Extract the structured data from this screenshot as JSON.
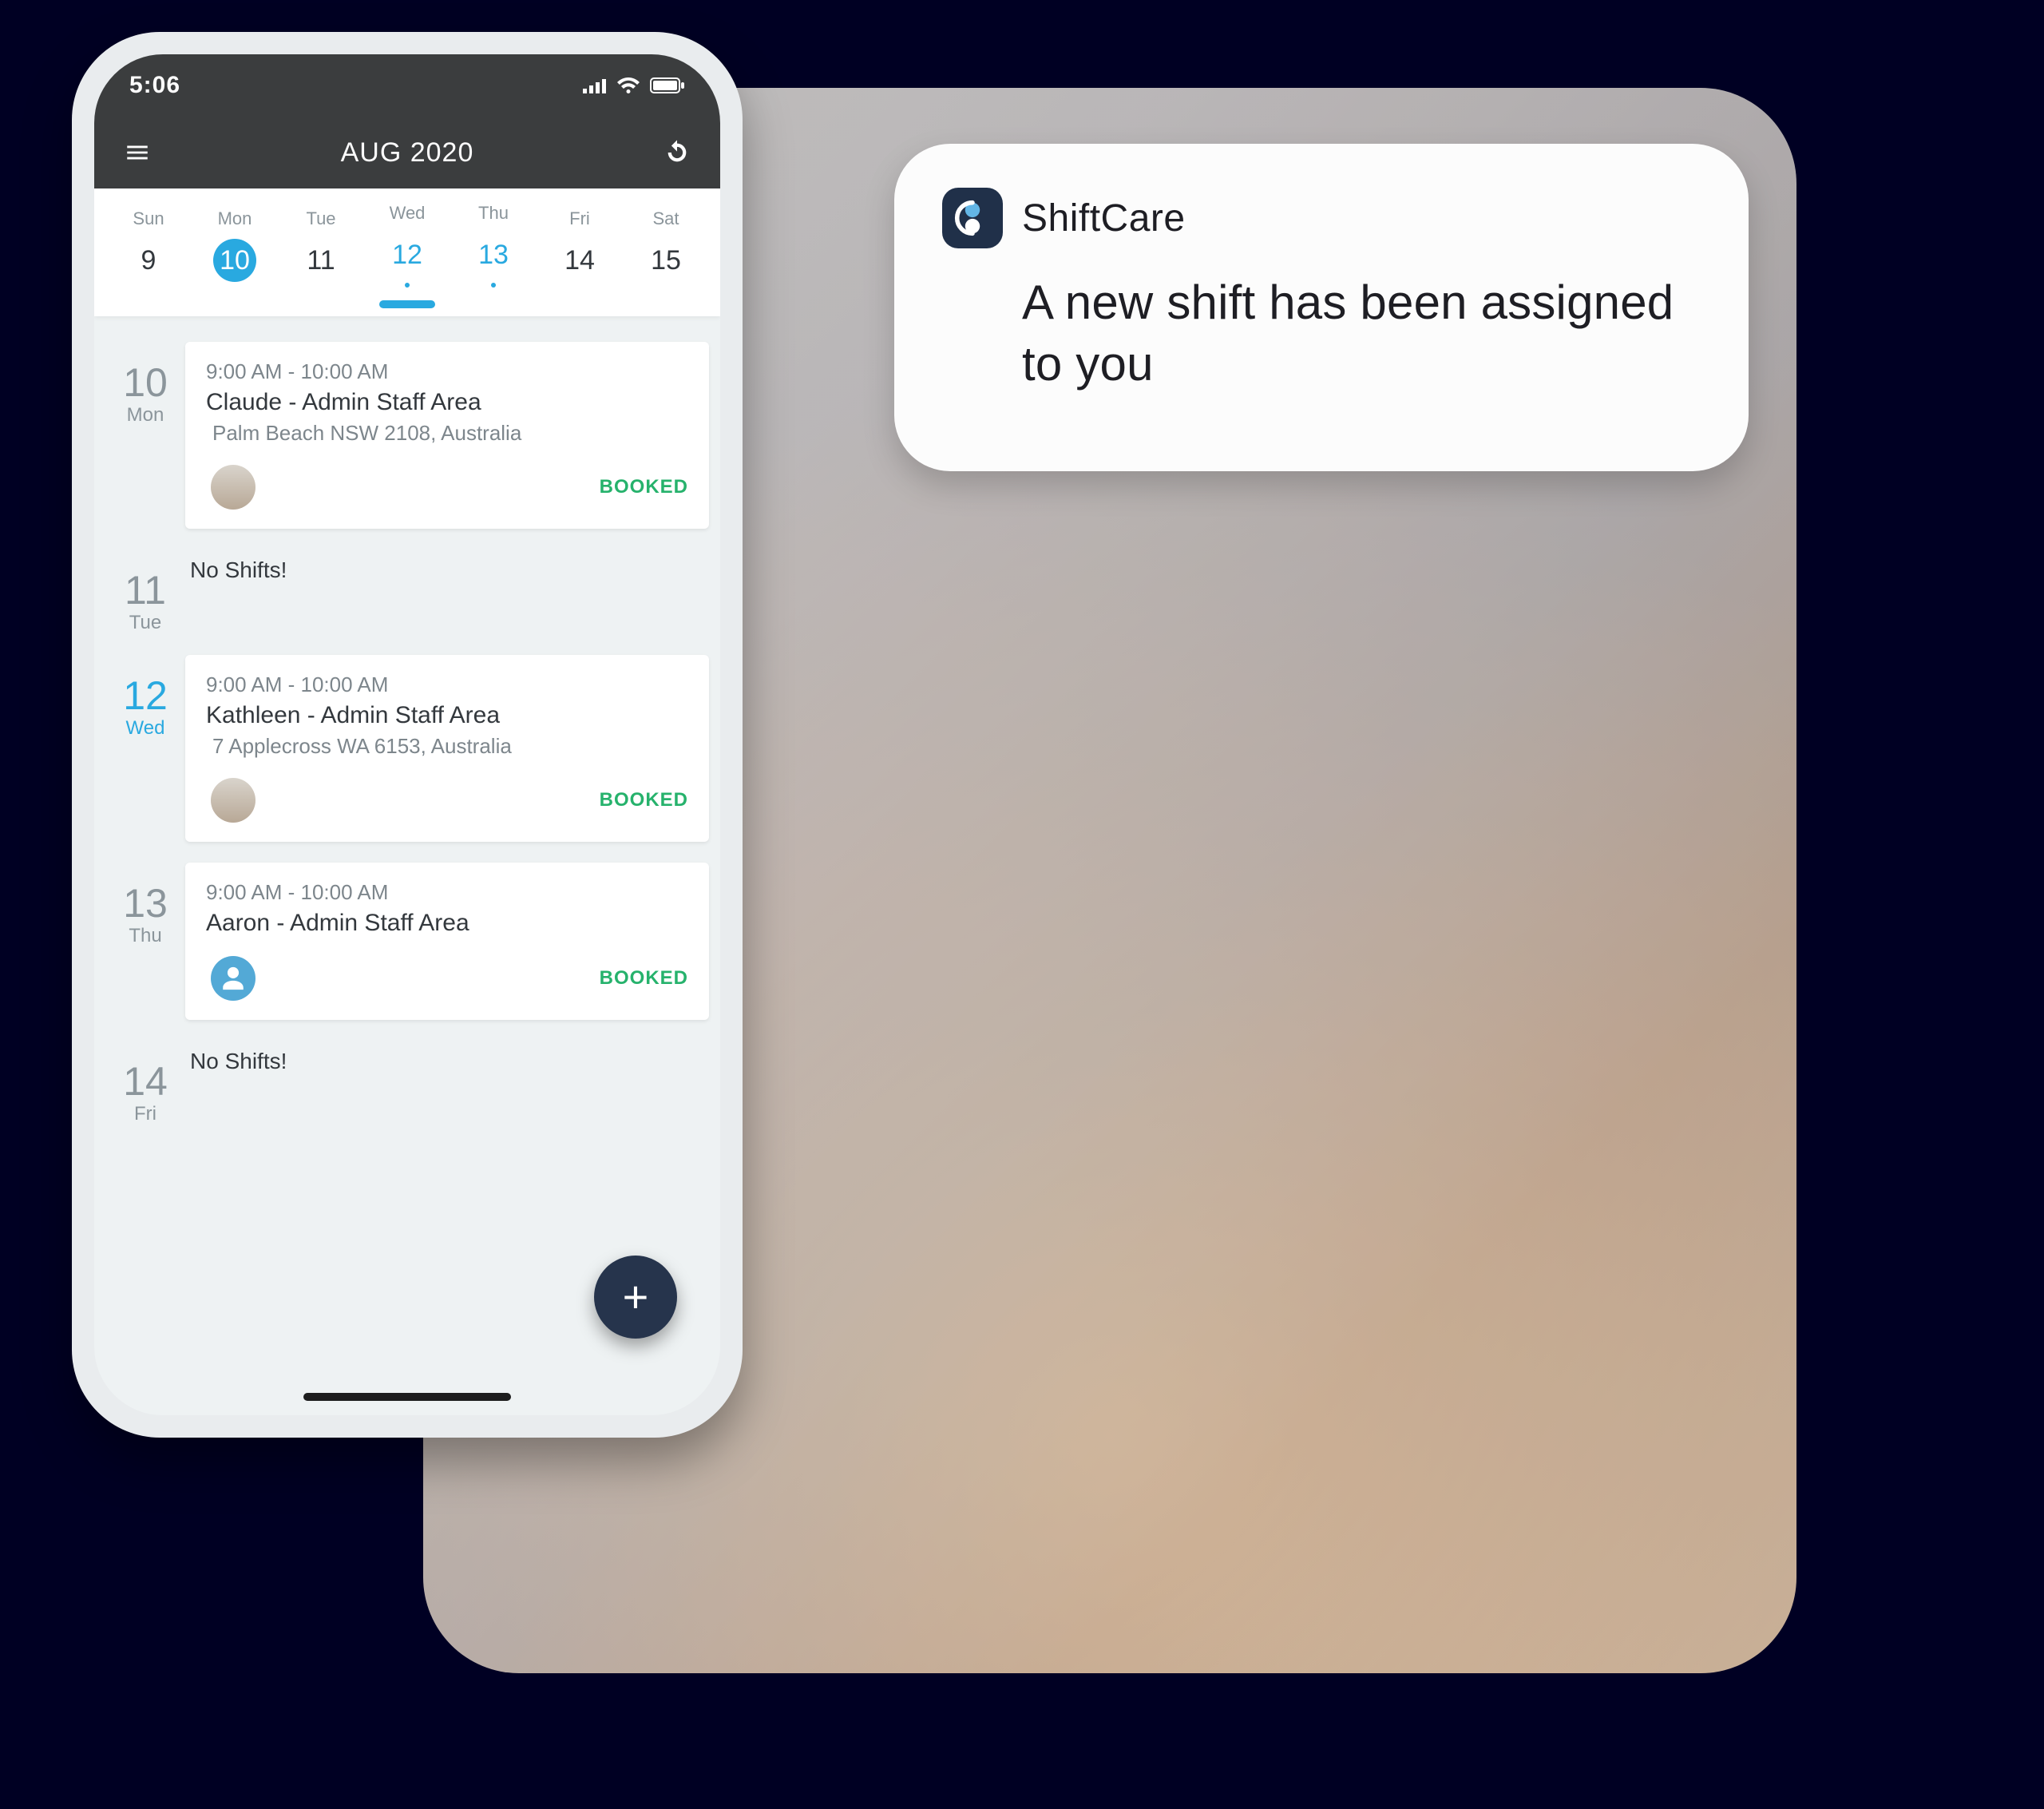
{
  "notification": {
    "app_name": "ShiftCare",
    "message": "A new shift has been assigned to you"
  },
  "phone": {
    "status": {
      "time": "5:06"
    },
    "header": {
      "title": "AUG 2020"
    },
    "week": {
      "days": [
        {
          "dow": "Sun",
          "num": "9",
          "state": "none"
        },
        {
          "dow": "Mon",
          "num": "10",
          "state": "today"
        },
        {
          "dow": "Tue",
          "num": "11",
          "state": "none"
        },
        {
          "dow": "Wed",
          "num": "12",
          "state": "dot"
        },
        {
          "dow": "Thu",
          "num": "13",
          "state": "dot"
        },
        {
          "dow": "Fri",
          "num": "14",
          "state": "none"
        },
        {
          "dow": "Sat",
          "num": "15",
          "state": "none"
        }
      ]
    },
    "list": [
      {
        "date_num": "10",
        "date_dow": "Mon",
        "active": false,
        "shifts": [
          {
            "time": "9:00 AM - 10:00 AM",
            "title": "Claude  - Admin Staff Area",
            "addr": "Palm Beach NSW 2108, Australia",
            "status": "BOOKED",
            "avatar": "photo"
          }
        ]
      },
      {
        "date_num": "11",
        "date_dow": "Tue",
        "active": false,
        "empty_text": "No Shifts!"
      },
      {
        "date_num": "12",
        "date_dow": "Wed",
        "active": true,
        "shifts": [
          {
            "time": "9:00 AM - 10:00 AM",
            "title": "Kathleen - Admin Staff Area",
            "addr": "7 Applecross WA 6153, Australia",
            "status": "BOOKED",
            "avatar": "photo"
          }
        ]
      },
      {
        "date_num": "13",
        "date_dow": "Thu",
        "active": false,
        "shifts": [
          {
            "time": "9:00 AM - 10:00 AM",
            "title": "Aaron - Admin Staff Area",
            "addr": "",
            "status": "BOOKED",
            "avatar": "placeholder"
          }
        ]
      },
      {
        "date_num": "14",
        "date_dow": "Fri",
        "active": false,
        "empty_text": "No Shifts!"
      }
    ],
    "fab": "+"
  }
}
